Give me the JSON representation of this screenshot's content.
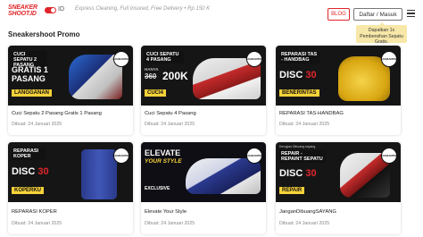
{
  "header": {
    "logo": "SNEAKER SHOOT.ID",
    "lang": "ID",
    "tagline": "Express Cleaning, Full Insured, Free Delivery • Rp 150 K",
    "blog_label": "BLOG",
    "login_label": "Daftar / Masuk"
  },
  "tooltip": "Dapatkan 1x Pembersihan Sepatu Gratis.",
  "section_title": "Sneakershoot Promo",
  "cards": [
    {
      "title": "Cuci Sepatu 2 Pasang Gratis 1 Pasang",
      "date": "Dibuat: 24 Januari 2025",
      "banner": {
        "top": "CUCI SEPATU 2 PASANG",
        "big": "GRATIS 1 PASANG",
        "cta": "LANGGANAN",
        "badge": "GUARANTEE"
      }
    },
    {
      "title": "Cuci Sepatu 4 Pasang",
      "date": "Dibuat: 24 Januari 2025",
      "banner": {
        "top": "CUCI SEPATU 4 PASANG",
        "hanya": "HANYA",
        "old": "360",
        "new": "200K",
        "cta": "CUCI4",
        "badge": "GUARANTEE"
      }
    },
    {
      "title": "REPARASI TAS-HANDBAG",
      "date": "Dibuat: 24 Januari 2025",
      "banner": {
        "top": "REPARASI TAS - HANDBAG",
        "disc": "DISC",
        "pct": "30",
        "cta": "BENERINTAS",
        "badge": "GUARANTEE"
      }
    },
    {
      "title": "REPARASI KOPER",
      "date": "Dibuat: 24 Januari 2025",
      "banner": {
        "top": "REPARASI KOPER",
        "disc": "DISC",
        "pct": "30",
        "cta": "KOPERKU",
        "badge": "GUARANTEE"
      }
    },
    {
      "title": "Elevate Your Style",
      "date": "Dibuat: 24 Januari 2025",
      "banner": {
        "top": "ELEVATE",
        "mid": "YOUR STYLE",
        "sub": "EXCLUSIVE",
        "badge": "GUARANTEE"
      }
    },
    {
      "title": "JanganDibuangSAYANG",
      "date": "Dibuat: 24 Januari 2025",
      "banner": {
        "small": "Kerugian Dibuang sayang",
        "top": "REPAIR - REPAINT SEPATU",
        "disc": "DISC",
        "pct": "30",
        "cta": "REPAIR",
        "badge": "GUARANTEE"
      }
    }
  ],
  "colors": {
    "brand_red": "#e0262b",
    "yellow": "#f7d23a",
    "tooltip_bg": "#f7e7a8"
  }
}
